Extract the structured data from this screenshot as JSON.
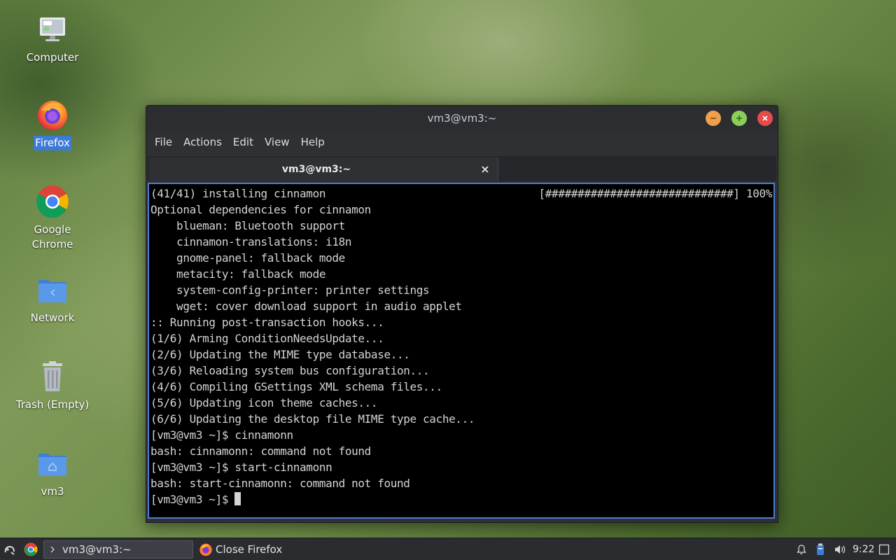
{
  "desktop": {
    "icons": [
      {
        "label": "Computer",
        "icon": "computer-icon"
      },
      {
        "label": "Firefox",
        "icon": "firefox-icon",
        "selected": true
      },
      {
        "label": "Google\nChrome",
        "icon": "chrome-icon"
      },
      {
        "label": "Network",
        "icon": "network-folder-icon"
      },
      {
        "label": "Trash (Empty)",
        "icon": "trash-icon"
      },
      {
        "label": "vm3",
        "icon": "home-folder-icon"
      }
    ]
  },
  "window": {
    "title": "vm3@vm3:~",
    "menu": [
      "File",
      "Actions",
      "Edit",
      "View",
      "Help"
    ],
    "tab_title": "vm3@vm3:~"
  },
  "terminal": {
    "progress": "[#############################] 100%",
    "lines": [
      "(41/41) installing cinnamon",
      "Optional dependencies for cinnamon",
      "    blueman: Bluetooth support",
      "    cinnamon-translations: i18n",
      "    gnome-panel: fallback mode",
      "    metacity: fallback mode",
      "    system-config-printer: printer settings",
      "    wget: cover download support in audio applet",
      ":: Running post-transaction hooks...",
      "(1/6) Arming ConditionNeedsUpdate...",
      "(2/6) Updating the MIME type database...",
      "(3/6) Reloading system bus configuration...",
      "(4/6) Compiling GSettings XML schema files...",
      "(5/6) Updating icon theme caches...",
      "(6/6) Updating the desktop file MIME type cache...",
      "[vm3@vm3 ~]$ cinnamonn",
      "bash: cinnamonn: command not found",
      "[vm3@vm3 ~]$ start-cinnamonn",
      "bash: start-cinnamonn: command not found"
    ],
    "prompt": "[vm3@vm3 ~]$ "
  },
  "taskbar": {
    "terminal_task": "vm3@vm3:~",
    "firefox_task": "Close Firefox",
    "clock": "9:22"
  },
  "colors": {
    "terminal_bg": "#000000",
    "terminal_fg": "#d4d4d4",
    "focus_border": "#4b7bd4",
    "selection": "#3d7ad6",
    "minimize": "#f0a04a",
    "maximize": "#8ccf58",
    "close": "#e54b4b"
  }
}
